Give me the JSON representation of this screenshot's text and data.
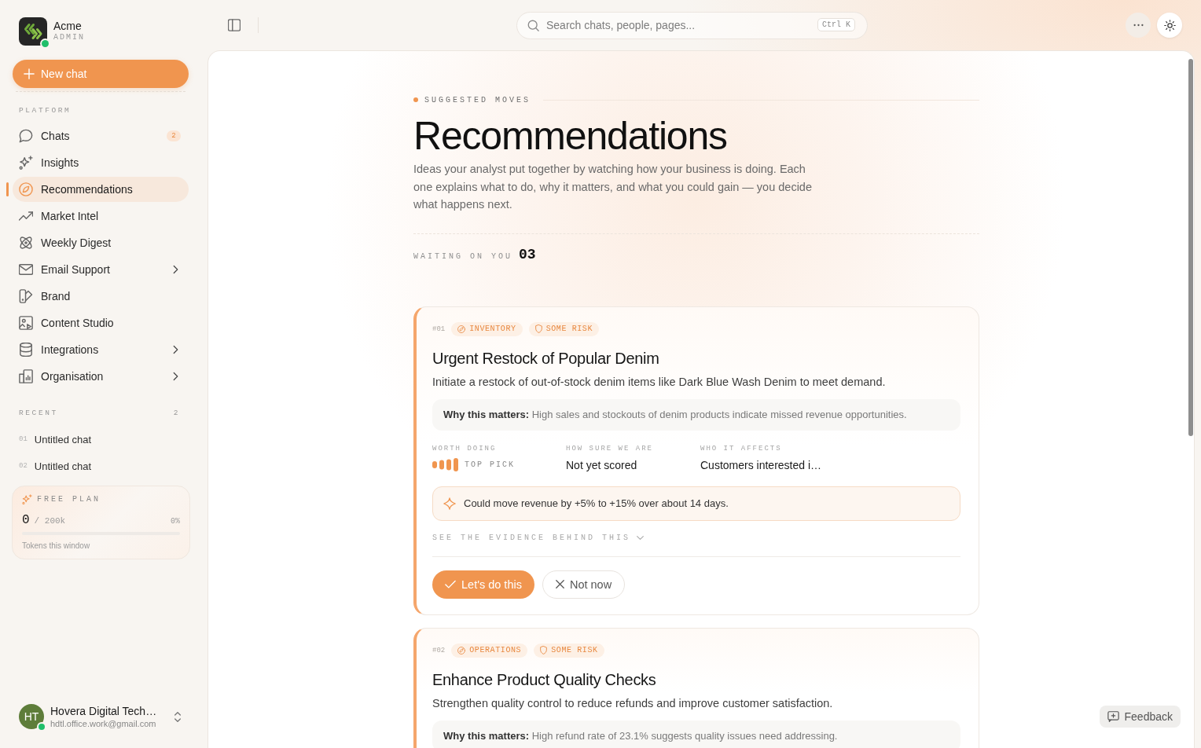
{
  "sidebar": {
    "brand": {
      "name": "Acme",
      "role": "ADMIN",
      "online": true
    },
    "new_chat_button": "New chat",
    "platform": {
      "label": "PLATFORM",
      "items": [
        {
          "label": "Chats",
          "badge": "2",
          "selected": false,
          "expandable": false
        },
        {
          "label": "Insights",
          "selected": false,
          "expandable": false
        },
        {
          "label": "Recommendations",
          "selected": true,
          "expandable": false
        },
        {
          "label": "Market Intel",
          "selected": false,
          "expandable": false
        },
        {
          "label": "Weekly Digest",
          "selected": false,
          "expandable": false
        },
        {
          "label": "Email Support",
          "selected": false,
          "expandable": true
        },
        {
          "label": "Brand",
          "selected": false,
          "expandable": false
        },
        {
          "label": "Content Studio",
          "selected": false,
          "expandable": false
        },
        {
          "label": "Integrations",
          "selected": false,
          "expandable": true
        },
        {
          "label": "Organisation",
          "selected": false,
          "expandable": true
        }
      ]
    },
    "recent": {
      "label": "RECENT",
      "count": "2",
      "items": [
        {
          "index": "01",
          "title": "Untitled chat"
        },
        {
          "index": "02",
          "title": "Untitled chat"
        }
      ]
    },
    "plan": {
      "label": "FREE PLAN",
      "used": "0",
      "limit": "/ 200k",
      "percent": "0%",
      "caption": "Tokens this window"
    },
    "user": {
      "initials": "HT",
      "name": "Hovera Digital Tech…",
      "email": "hdtl.office.work@gmail.com",
      "online": true
    }
  },
  "top_bar": {
    "search": {
      "placeholder": "Search chats, people, pages...",
      "shortcut": "Ctrl K"
    }
  },
  "page": {
    "eyebrow": "SUGGESTED MOVES",
    "title": "Recommendations",
    "description": "Ideas your analyst put together by watching how your business is doing. Each one explains what to do, why it matters, and what you could gain — you decide what happens next.",
    "waiting_label": "WAITING ON YOU",
    "waiting_count": "03"
  },
  "recommendations": [
    {
      "number": "#01",
      "category": "INVENTORY",
      "risk": "SOME RISK",
      "title": "Urgent Restock of Popular Denim",
      "summary": "Initiate a restock of out-of-stock denim items like Dark Blue Wash Denim to meet demand.",
      "why": "**Why this matters:** High sales and stockouts of denim products indicate missed revenue opportunities.",
      "worth_doing": {
        "label": "WORTH DOING",
        "value": "TOP PICK",
        "level": 1
      },
      "confidence": {
        "label": "HOW SURE WE ARE",
        "value": "Not yet scored"
      },
      "audience": {
        "label": "WHO IT AFFECTS",
        "value": "Customers interested i…"
      },
      "gain": "Could move revenue by +5% to +15% over about 14 days.",
      "evidence": {
        "label": "SEE THE EVIDENCE BEHIND THIS",
        "expanded": false
      },
      "actions": {
        "accept": "Let's do this",
        "dismiss": "Not now"
      }
    },
    {
      "number": "#02",
      "category": "OPERATIONS",
      "risk": "SOME RISK",
      "title": "Enhance Product Quality Checks",
      "summary": "Strengthen quality control to reduce refunds and improve customer satisfaction.",
      "why": "**Why this matters:** High refund rate of 23.1% suggests quality issues need addressing."
    }
  ],
  "feedback_button": "Feedback"
}
